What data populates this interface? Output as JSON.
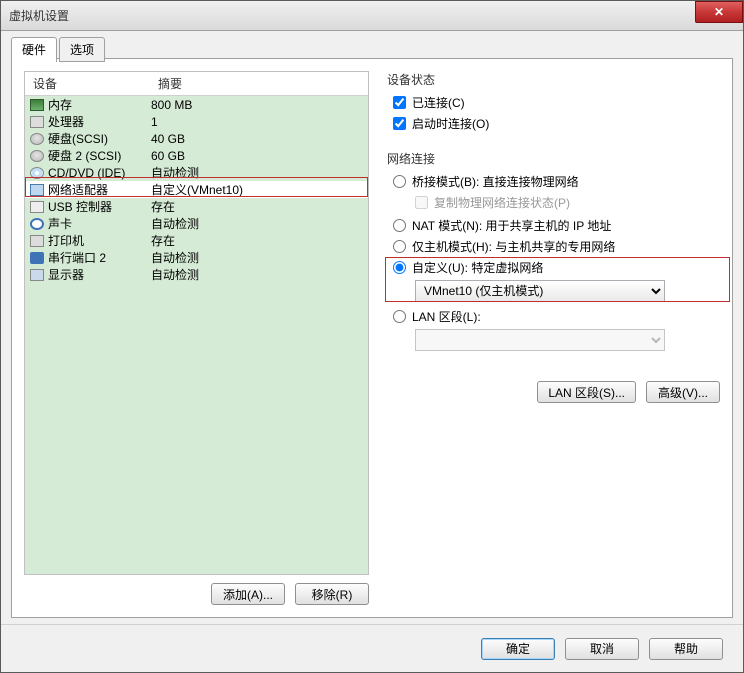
{
  "window": {
    "title": "虚拟机设置"
  },
  "tabs": {
    "hardware": "硬件",
    "options": "选项"
  },
  "listHeader": {
    "device": "设备",
    "summary": "摘要"
  },
  "devices": [
    {
      "icon": "ic-mem",
      "name": "内存",
      "summary": "800 MB"
    },
    {
      "icon": "ic-cpu",
      "name": "处理器",
      "summary": "1"
    },
    {
      "icon": "ic-hdd",
      "name": "硬盘(SCSI)",
      "summary": "40 GB"
    },
    {
      "icon": "ic-hdd",
      "name": "硬盘 2 (SCSI)",
      "summary": "60 GB"
    },
    {
      "icon": "ic-cd",
      "name": "CD/DVD (IDE)",
      "summary": "自动检测"
    },
    {
      "icon": "ic-net",
      "name": "网络适配器",
      "summary": "自定义(VMnet10)"
    },
    {
      "icon": "ic-usb",
      "name": "USB 控制器",
      "summary": "存在"
    },
    {
      "icon": "ic-snd",
      "name": "声卡",
      "summary": "自动检测"
    },
    {
      "icon": "ic-prn",
      "name": "打印机",
      "summary": "存在"
    },
    {
      "icon": "ic-ser",
      "name": "串行端口 2",
      "summary": "自动检测"
    },
    {
      "icon": "ic-disp",
      "name": "显示器",
      "summary": "自动检测"
    }
  ],
  "selectedIndex": 5,
  "leftButtons": {
    "add": "添加(A)...",
    "remove": "移除(R)"
  },
  "status": {
    "title": "设备状态",
    "connected": "已连接(C)",
    "connectAtPowerOn": "启动时连接(O)"
  },
  "network": {
    "title": "网络连接",
    "bridged": "桥接模式(B): 直接连接物理网络",
    "replicate": "复制物理网络连接状态(P)",
    "nat": "NAT 模式(N): 用于共享主机的 IP 地址",
    "hostOnly": "仅主机模式(H): 与主机共享的专用网络",
    "custom": "自定义(U): 特定虚拟网络",
    "customValue": "VMnet10 (仅主机模式)",
    "lan": "LAN 区段(L):",
    "lanValue": ""
  },
  "rightButtons": {
    "lanSegments": "LAN 区段(S)...",
    "advanced": "高级(V)..."
  },
  "bottom": {
    "ok": "确定",
    "cancel": "取消",
    "help": "帮助"
  }
}
